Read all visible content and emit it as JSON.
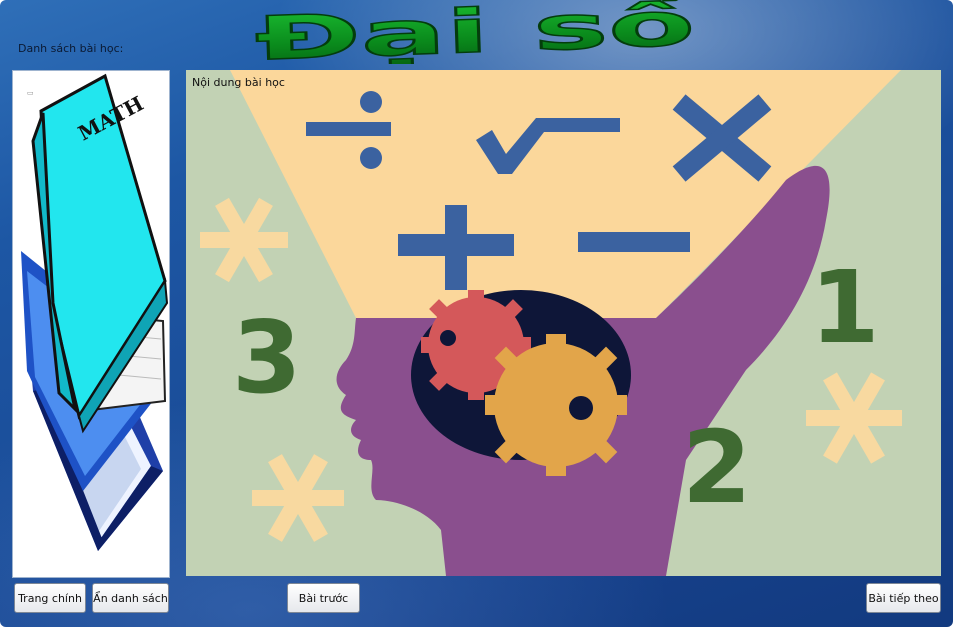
{
  "window": {
    "title_art_text": "Đại số",
    "list_label": "Danh sách bài học:",
    "content_label": "Nội dung bài học"
  },
  "book_image": {
    "label": "MATH"
  },
  "illustration": {
    "operators": [
      "÷",
      "√",
      "×",
      "+",
      "−"
    ],
    "numbers": [
      "3",
      "1",
      "2"
    ]
  },
  "buttons": {
    "home": "Trang chính",
    "hide_list": "Ẩn danh sách",
    "prev": "Bài trước",
    "next": "Bài tiếp theo"
  },
  "colors": {
    "title_green": "#0a8a1c",
    "background_blue": "#1d57a4",
    "op_blue": "#3b62a0",
    "head_purple": "#8a4f8e",
    "number_green": "#3f6a32",
    "asterisk_peach": "#f8d9a0"
  }
}
